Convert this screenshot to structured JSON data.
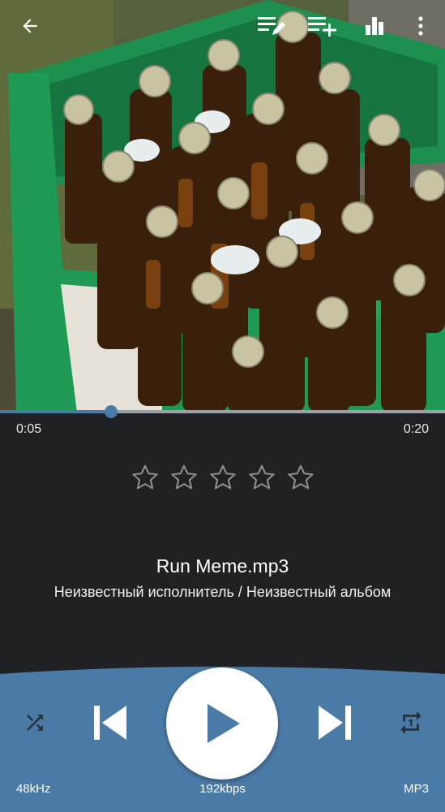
{
  "colors": {
    "accent": "#4a7aa6",
    "panel": "#4a7aa6",
    "background": "#202124"
  },
  "top_bar": {
    "back_icon": "arrow-left-icon",
    "edit_queue_icon": "playlist-edit-icon",
    "add_to_playlist_icon": "playlist-add-icon",
    "equalizer_icon": "equalizer-icon",
    "more_icon": "more-vert-icon"
  },
  "progress": {
    "elapsed": "0:05",
    "duration": "0:20",
    "fraction": 0.25
  },
  "rating": {
    "stars_total": 5,
    "stars_filled": 0
  },
  "track": {
    "title": "Run Meme.mp3",
    "subtitle": "Неизвестный исполнитель / Неизвестный альбом"
  },
  "controls": {
    "shuffle_icon": "shuffle-icon",
    "previous_icon": "skip-previous-icon",
    "play_icon": "play-icon",
    "next_icon": "skip-next-icon",
    "repeat_icon": "repeat-one-icon"
  },
  "audio_info": {
    "sample_rate": "48kHz",
    "bitrate": "192kbps",
    "format": "MP3"
  }
}
